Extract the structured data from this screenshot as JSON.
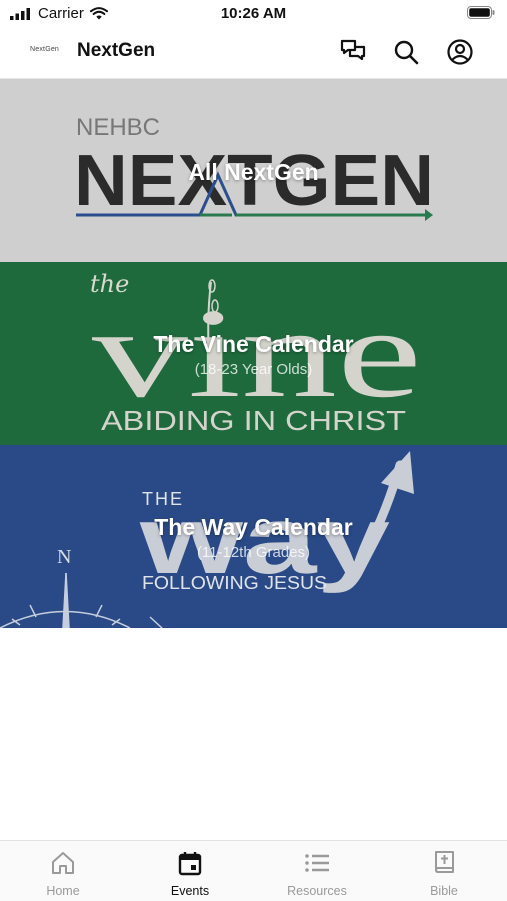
{
  "status_bar": {
    "carrier": "Carrier",
    "time": "10:26 AM"
  },
  "header": {
    "logo_text": "NextGen",
    "title": "NextGen",
    "icons": [
      "chat-icon",
      "search-icon",
      "account-icon"
    ]
  },
  "banners": [
    {
      "logo_top": "NEHBC",
      "logo_main": "NEXTGEN",
      "title": "All NextGen",
      "subtitle": ""
    },
    {
      "logo_script": "the",
      "logo_main": "vine",
      "logo_tagline": "ABIDING IN CHRIST",
      "title": "The Vine Calendar",
      "subtitle": "(18-23 Year Olds)"
    },
    {
      "logo_top": "THE",
      "logo_main": "way",
      "logo_tagline": "FOLLOWING JESUS",
      "compass_letter": "N",
      "title": "The Way Calendar",
      "subtitle": "(11-12th Grades)"
    }
  ],
  "colors": {
    "nextgen_bg": "#cfcfcf",
    "vine_bg": "#1e6a3d",
    "way_bg": "#2a4a87",
    "accent_blue": "#2b4f8e",
    "accent_green": "#2a7a4f"
  },
  "tabs": [
    {
      "label": "Home",
      "icon": "home-icon",
      "active": false
    },
    {
      "label": "Events",
      "icon": "calendar-icon",
      "active": true
    },
    {
      "label": "Resources",
      "icon": "list-icon",
      "active": false
    },
    {
      "label": "Bible",
      "icon": "bible-icon",
      "active": false
    }
  ]
}
